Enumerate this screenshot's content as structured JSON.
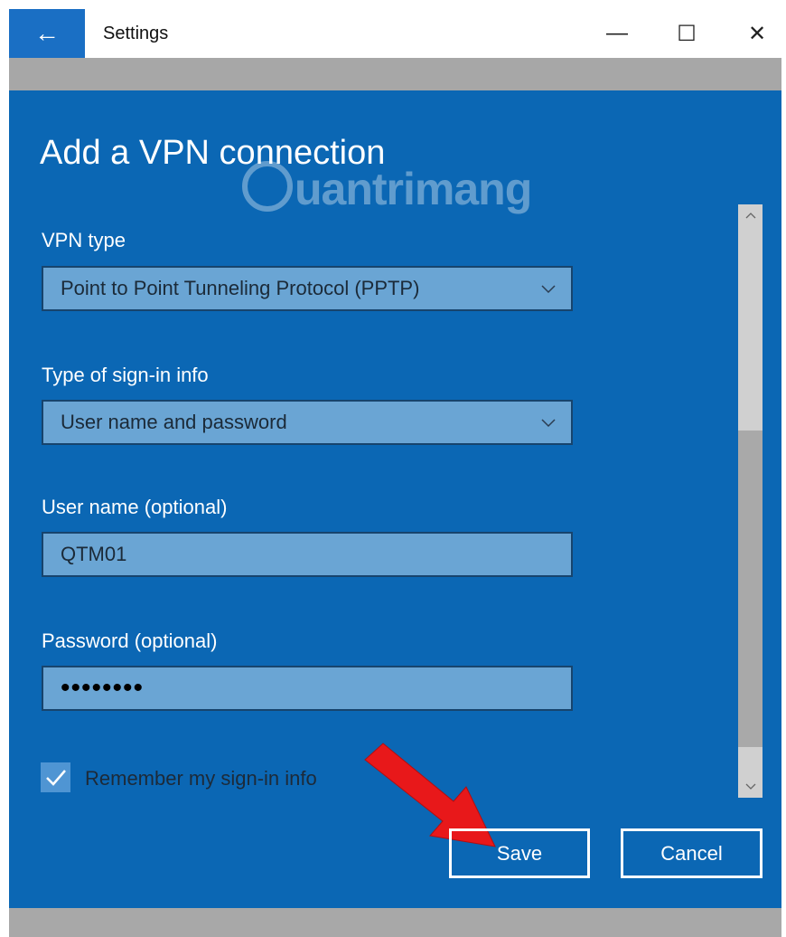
{
  "window": {
    "title": "Settings",
    "back_icon": "←",
    "minimize_icon": "—",
    "maximize_icon": "☐",
    "close_icon": "✕"
  },
  "page": {
    "heading": "Add a VPN connection",
    "watermark": "uantrimang"
  },
  "form": {
    "vpn_type_label": "VPN type",
    "vpn_type_value": "Point to Point Tunneling Protocol (PPTP)",
    "signin_type_label": "Type of sign-in info",
    "signin_type_value": "User name and password",
    "username_label": "User name (optional)",
    "username_value": "QTM01",
    "password_label": "Password (optional)",
    "password_masked": "••••••••",
    "remember_label": "Remember my sign-in info",
    "remember_checked": true
  },
  "actions": {
    "save_label": "Save",
    "cancel_label": "Cancel"
  },
  "colors": {
    "accent": "#0b67b4",
    "field_bg": "#6aa5d4",
    "arrow": "#e8181a"
  }
}
